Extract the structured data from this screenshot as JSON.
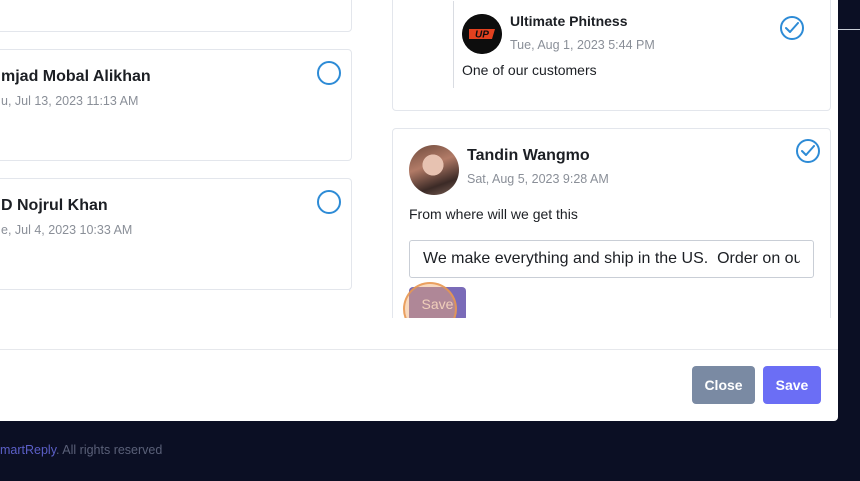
{
  "comments": [
    {
      "name": "mjad Mobal Alikhan",
      "date": "u, Jul 13, 2023 11:13 AM",
      "selected": false
    },
    {
      "name": "D Nojrul Khan",
      "date": "e, Jul 4, 2023 10:33 AM",
      "selected": false
    }
  ],
  "top_reply": {
    "name": "Ultimate Phitness",
    "date": "Tue, Aug 1, 2023 5:44 PM",
    "message": "One of our customers",
    "avatar_text": "UP",
    "selected": true
  },
  "active_comment": {
    "name": "Tandin Wangmo",
    "date": "Sat, Aug 5, 2023 9:28 AM",
    "message": "From where will we get this",
    "reply_value": "We make everything and ship in the US.  Order on our",
    "save_label": "Save",
    "selected": true
  },
  "modal_footer": {
    "close_label": "Close",
    "save_label": "Save"
  },
  "page_footer": {
    "brand": "martReply",
    "rights": ". All rights reserved"
  },
  "colors": {
    "accent": "#6b6ef5",
    "close_button": "#7a8aa3",
    "check_blue": "#2d8bd6",
    "page_bg": "#0b0f24"
  }
}
